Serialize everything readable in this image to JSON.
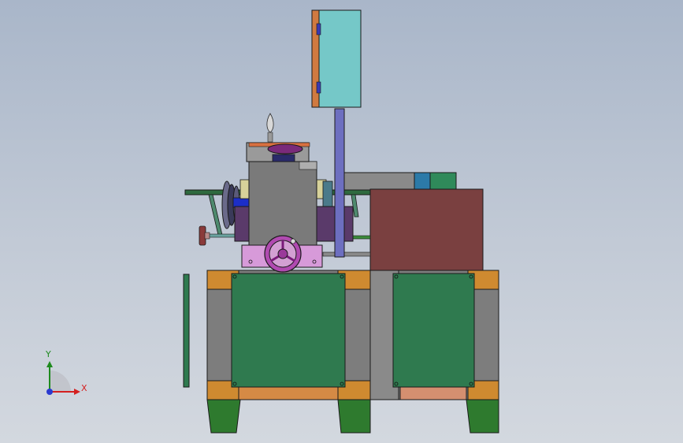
{
  "window": {
    "type": "cad-graphics-area",
    "background_top": "#a9b6c9",
    "background_bottom": "#d3d8df"
  },
  "colors": {
    "cabinet_teal": "#75c8c8",
    "cabinet_hinge": "#d07a40",
    "column_blue": "#6d6fc0",
    "base_green": "#2f7a4f",
    "base_green_dark": "#1f5a38",
    "corner_orange": "#cf8a30",
    "frame_grey": "#7d7d7d",
    "tray_brown": "#7a4040",
    "handwheel_magenta": "#b04ab0",
    "bracket_pink": "#d79ad9",
    "outline": "#1a1a1a"
  },
  "triad": {
    "x_label": "X",
    "y_label": "Y",
    "x_color": "#d42020",
    "y_color": "#1e8a1e",
    "z_color": "#2a3ad0"
  },
  "icons": [
    "coordinate-triad-icon",
    "handwheel-icon"
  ]
}
